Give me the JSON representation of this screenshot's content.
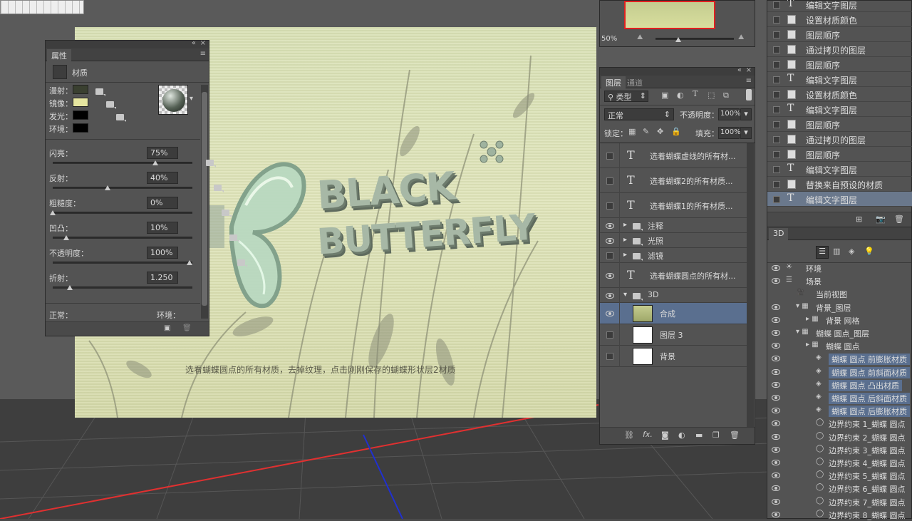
{
  "properties_panel": {
    "tab": "属性",
    "section": "材质",
    "diffuse_label": "漫射：",
    "specular_label": "镜像：",
    "illumination_label": "发光：",
    "ambient_label": "环境：",
    "diffuse_color": "#3a4030",
    "specular_color": "#e6e6a0",
    "illumination_color": "#000000",
    "ambient_color": "#000000",
    "shine_label": "闪亮：",
    "shine_value": "75%",
    "shine_level": 0.75,
    "reflection_label": "反射：",
    "reflection_value": "40%",
    "reflection_level": 0.4,
    "roughness_label": "粗糙度：",
    "roughness_value": "0%",
    "roughness_level": 0,
    "bump_label": "凹凸：",
    "bump_value": "10%",
    "bump_level": 0.1,
    "opacity_label": "不透明度：",
    "opacity_value": "100%",
    "opacity_level": 1.0,
    "refraction_label": "折射：",
    "refraction_value": "1.250",
    "normal_label": "正常：",
    "environment_label": "环境："
  },
  "canvas": {
    "caption": "选看蝴蝶圆点的所有材质，去掉纹理，点击刚刚保存的蝴蝶形状层2材质"
  },
  "navigator": {
    "zoom": "50%"
  },
  "layers_panel": {
    "tab_layers": "图层",
    "tab_channels": "通道",
    "filter_kind": "类型",
    "blend_mode": "正常",
    "opacity_label": "不透明度：",
    "opacity_value": "100%",
    "lock_label": "锁定：",
    "fill_label": "填充：",
    "fill_value": "100%",
    "layers": [
      {
        "kind": "text",
        "name": "选着蝴蝶虚线的所有材...",
        "visible": false
      },
      {
        "kind": "text",
        "name": "选着蝴蝶2的所有材质...",
        "visible": false
      },
      {
        "kind": "text",
        "name": "选着蝴蝶1的所有材质...",
        "visible": false
      },
      {
        "kind": "group",
        "name": "注释",
        "visible": true
      },
      {
        "kind": "group",
        "name": "光照",
        "visible": true
      },
      {
        "kind": "group",
        "name": "滤镜",
        "visible": false
      },
      {
        "kind": "text",
        "name": "选着蝴蝶圆点的所有材...",
        "visible": true
      },
      {
        "kind": "group-open",
        "name": "3D",
        "visible": true
      },
      {
        "kind": "smart",
        "name": "合成",
        "visible": true,
        "selected": true
      },
      {
        "kind": "white",
        "name": "图层 3",
        "visible": false
      },
      {
        "kind": "bg",
        "name": "背景",
        "visible": false
      }
    ]
  },
  "history_panel": {
    "items": [
      {
        "icon": "text",
        "label": "编辑文字图层"
      },
      {
        "icon": "doc",
        "label": "设置材质颜色"
      },
      {
        "icon": "doc",
        "label": "图层顺序"
      },
      {
        "icon": "doc",
        "label": "通过拷贝的图层"
      },
      {
        "icon": "doc",
        "label": "图层顺序"
      },
      {
        "icon": "text",
        "label": "编辑文字图层"
      },
      {
        "icon": "doc",
        "label": "设置材质颜色"
      },
      {
        "icon": "text",
        "label": "编辑文字图层"
      },
      {
        "icon": "doc",
        "label": "图层顺序"
      },
      {
        "icon": "doc",
        "label": "通过拷贝的图层"
      },
      {
        "icon": "doc",
        "label": "图层顺序"
      },
      {
        "icon": "text",
        "label": "编辑文字图层"
      },
      {
        "icon": "doc",
        "label": "替换来自预设的材质"
      },
      {
        "icon": "text",
        "label": "编辑文字图层",
        "selected": true
      }
    ]
  },
  "three_d_panel": {
    "tab": "3D",
    "items": [
      {
        "label": "环境",
        "indent": 0,
        "eye": true,
        "sel": false
      },
      {
        "label": "场景",
        "indent": 0,
        "eye": true,
        "sel": false
      },
      {
        "label": "当前视图",
        "indent": 1,
        "eye": false,
        "sel": false
      },
      {
        "label": "背景_图层",
        "indent": 1,
        "eye": true,
        "sel": false
      },
      {
        "label": "背景 网格",
        "indent": 2,
        "eye": true,
        "sel": false
      },
      {
        "label": "蝴蝶 圆点_图层",
        "indent": 1,
        "eye": true,
        "sel": false
      },
      {
        "label": "蝴蝶 圆点",
        "indent": 2,
        "eye": true,
        "sel": false
      },
      {
        "label": "蝴蝶 圆点 前膨胀材质",
        "indent": 3,
        "eye": true,
        "sel": true
      },
      {
        "label": "蝴蝶 圆点 前斜面材质",
        "indent": 3,
        "eye": true,
        "sel": true
      },
      {
        "label": "蝴蝶 圆点 凸出材质",
        "indent": 3,
        "eye": true,
        "sel": true
      },
      {
        "label": "蝴蝶 圆点 后斜面材质",
        "indent": 3,
        "eye": true,
        "sel": true
      },
      {
        "label": "蝴蝶 圆点 后膨胀材质",
        "indent": 3,
        "eye": true,
        "sel": true
      },
      {
        "label": "边界约束 1_蝴蝶 圆点",
        "indent": 3,
        "eye": true,
        "sel": false
      },
      {
        "label": "边界约束 2_蝴蝶 圆点",
        "indent": 3,
        "eye": true,
        "sel": false
      },
      {
        "label": "边界约束 3_蝴蝶 圆点",
        "indent": 3,
        "eye": true,
        "sel": false
      },
      {
        "label": "边界约束 4_蝴蝶 圆点",
        "indent": 3,
        "eye": true,
        "sel": false
      },
      {
        "label": "边界约束 5_蝴蝶 圆点",
        "indent": 3,
        "eye": true,
        "sel": false
      },
      {
        "label": "边界约束 6_蝴蝶 圆点",
        "indent": 3,
        "eye": true,
        "sel": false
      },
      {
        "label": "边界约束 7_蝴蝶 圆点",
        "indent": 3,
        "eye": true,
        "sel": false
      },
      {
        "label": "边界约束 8_蝴蝶 圆点",
        "indent": 3,
        "eye": true,
        "sel": false
      }
    ]
  },
  "colors": {
    "panel_bg": "#535353",
    "selection": "#5a6f8f",
    "axis_red": "#e03030",
    "axis_blue": "#2030d0"
  }
}
